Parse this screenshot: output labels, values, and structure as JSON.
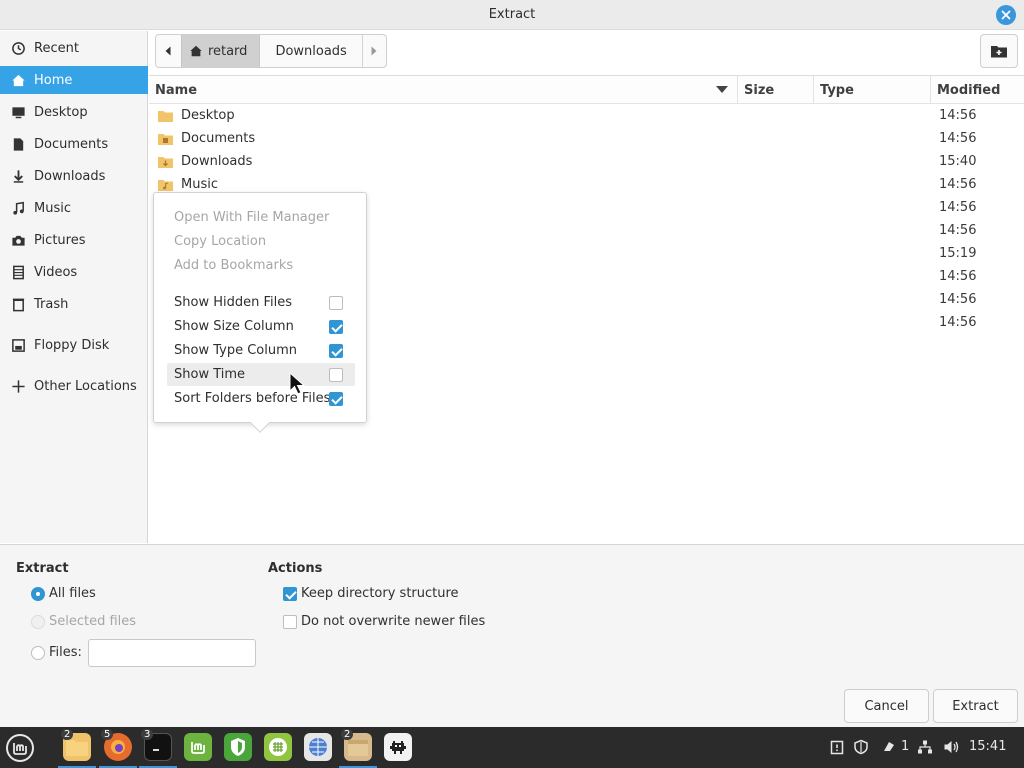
{
  "window": {
    "title": "Extract"
  },
  "sidebar": {
    "items": [
      {
        "label": "Recent",
        "icon": "clock-icon"
      },
      {
        "label": "Home",
        "icon": "home-icon",
        "active": true
      },
      {
        "label": "Desktop",
        "icon": "desktop-icon"
      },
      {
        "label": "Documents",
        "icon": "document-icon"
      },
      {
        "label": "Downloads",
        "icon": "download-icon"
      },
      {
        "label": "Music",
        "icon": "music-icon"
      },
      {
        "label": "Pictures",
        "icon": "camera-icon"
      },
      {
        "label": "Videos",
        "icon": "film-icon"
      },
      {
        "label": "Trash",
        "icon": "trash-icon"
      },
      {
        "label": "Floppy Disk",
        "icon": "floppy-icon"
      },
      {
        "label": "Other Locations",
        "icon": "plus-icon"
      }
    ]
  },
  "pathbar": {
    "home": "retard",
    "current": "Downloads"
  },
  "columns": {
    "name": "Name",
    "size": "Size",
    "type": "Type",
    "modified": "Modified"
  },
  "files": [
    {
      "name": "Desktop",
      "modified": "14:56"
    },
    {
      "name": "Documents",
      "modified": "14:56"
    },
    {
      "name": "Downloads",
      "modified": "15:40"
    },
    {
      "name": "Music",
      "modified": "14:56"
    },
    {
      "name": "",
      "modified": "14:56"
    },
    {
      "name": "",
      "modified": "14:56"
    },
    {
      "name": "",
      "modified": "15:19"
    },
    {
      "name": "",
      "modified": "14:56"
    },
    {
      "name": "",
      "modified": "14:56"
    },
    {
      "name": "",
      "modified": "14:56"
    }
  ],
  "menu": {
    "open_with": "Open With File Manager",
    "copy_location": "Copy Location",
    "add_bookmarks": "Add to Bookmarks",
    "show_hidden": {
      "label": "Show Hidden Files",
      "checked": false
    },
    "show_size": {
      "label": "Show Size Column",
      "checked": true
    },
    "show_type": {
      "label": "Show Type Column",
      "checked": true
    },
    "show_time": {
      "label": "Show Time",
      "checked": false
    },
    "sort_folders": {
      "label": "Sort Folders before Files",
      "checked": true
    }
  },
  "extract": {
    "heading": "Extract",
    "all_files": "All files",
    "selected_files": "Selected files",
    "files_label": "Files:",
    "files_value": ""
  },
  "actions": {
    "heading": "Actions",
    "keep_structure": "Keep directory structure",
    "no_overwrite": "Do not overwrite newer files"
  },
  "buttons": {
    "cancel": "Cancel",
    "extract": "Extract"
  },
  "taskbar": {
    "badges": {
      "files": "2",
      "firefox": "5",
      "terminal": "3",
      "folder": "2"
    },
    "tray_count": "1",
    "clock": "15:41"
  },
  "colors": {
    "accent": "#35a3e6",
    "folder": "#f2c469",
    "taskbar": "#2b2b2b"
  }
}
